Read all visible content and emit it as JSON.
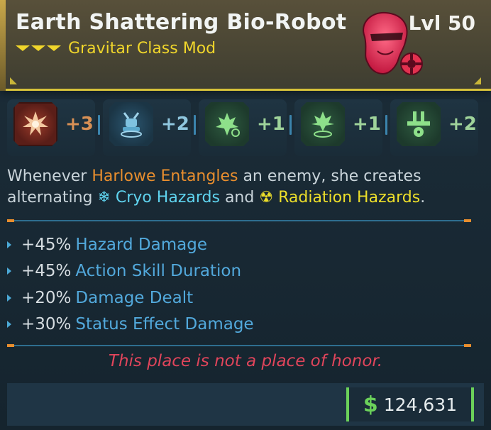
{
  "item": {
    "name": "Earth Shattering Bio-Robot",
    "type": "Gravitar Class Mod",
    "level": "Lvl 50",
    "colors": {
      "header_bg": "#4a4634",
      "accent_gold": "#d7c23a",
      "type_yellow": "#f0d62b"
    }
  },
  "skills": [
    {
      "icon": "explosion-skill-icon",
      "value": "+3",
      "color": "#d89055"
    },
    {
      "icon": "robot-mech-skill-icon",
      "value": "+2",
      "color": "#8fc6de"
    },
    {
      "icon": "hazard-burst-skill-icon",
      "value": "+1",
      "color": "#9fd39a"
    },
    {
      "icon": "hazard-spread-skill-icon",
      "value": "+1",
      "color": "#9fd39a"
    },
    {
      "icon": "radiation-cannon-skill-icon",
      "value": "+2",
      "color": "#9fd39a"
    }
  ],
  "description": {
    "part1": "Whenever ",
    "highlight1": "Harlowe Entangles",
    "part2": " an enemy, she creates alternating ",
    "cryo_icon": "snowflake-icon",
    "highlight2": "Cryo Hazards",
    "part3": " and ",
    "radiation_icon": "radiation-icon",
    "highlight3": "Radiation Hazards",
    "part4": "."
  },
  "stats": [
    {
      "value": "+45%",
      "name": "Hazard Damage"
    },
    {
      "value": "+45%",
      "name": "Action Skill Duration"
    },
    {
      "value": "+20%",
      "name": "Damage Dealt"
    },
    {
      "value": "+30%",
      "name": "Status Effect Damage"
    }
  ],
  "flavor_text": "This place is not a place of honor.",
  "price": {
    "currency_symbol": "$",
    "value": "124,631",
    "color": "#6bd15a"
  }
}
